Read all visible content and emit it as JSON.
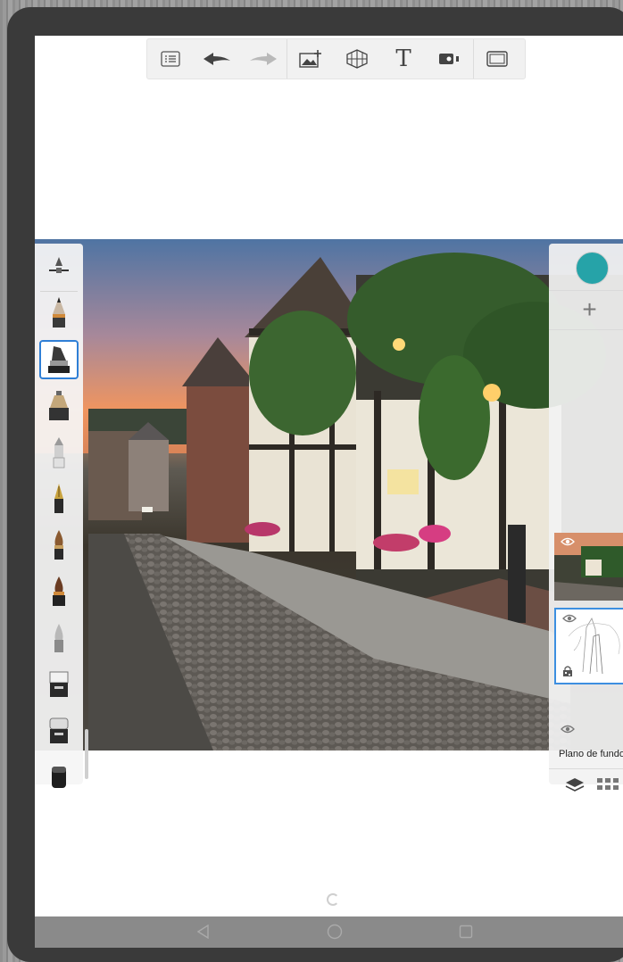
{
  "toolbar": {
    "items": [
      "menu-icon",
      "undo-icon",
      "redo-icon",
      "add-image-icon",
      "perspective-grid-icon",
      "text-icon",
      "record-icon",
      "fullscreen-icon"
    ],
    "text_tool_label": "T"
  },
  "brushes": {
    "items": [
      "ruler-tool",
      "pencil",
      "marker",
      "airbrush",
      "paint-brush",
      "fountain-pen",
      "round-brush",
      "ink-brush",
      "smudge",
      "eraser-hard",
      "eraser-soft",
      "fill"
    ],
    "selected_index": 2
  },
  "layers": {
    "current_color": "#26a3a8",
    "add_label": "+",
    "items": [
      {
        "name": "photo-layer",
        "visible": true
      },
      {
        "name": "sketch-layer",
        "visible": true,
        "locked": true
      }
    ],
    "background_label": "Plano de fundo"
  },
  "colors": {
    "accent": "#2f7fd6",
    "selected_layer_border": "#3d8fe0",
    "nav_bar": "#8a8a8a"
  }
}
